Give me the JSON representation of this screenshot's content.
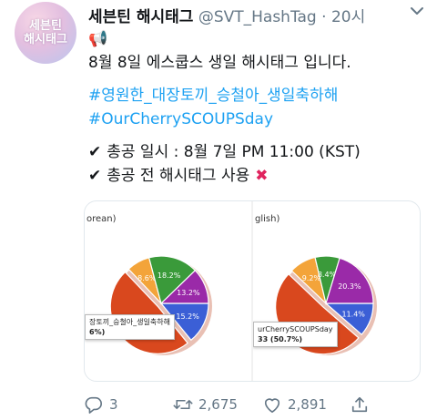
{
  "tweet": {
    "avatar_text": [
      "세븐틴",
      "해시태그"
    ],
    "display_name": "세븐틴 해시태그",
    "handle": "@SVT_HashTag",
    "separator": "·",
    "time": "20시",
    "lines": {
      "megaphone": "📢",
      "announcement": "8월 8일 에스쿱스 생일 해시태그 입니다.",
      "hashtag_korean": "#영원한_대장토끼_승철아_생일축하해",
      "hashtag_english": "#OurCherrySCOUPSday",
      "check_mark": "✔",
      "schedule": "총공 일시 : 8월 7일 PM 11:00 (KST)",
      "rule": "총공 전 해시태그 사용",
      "cross_mark": "✖"
    }
  },
  "media": {
    "left": {
      "label": "orean)",
      "tooltip_label": "장토끼_승철아_생일축하해",
      "tooltip_value": "6%)"
    },
    "right": {
      "label": "glish)",
      "tooltip_label": "urCherrySCOUPSday",
      "tooltip_value": "33 (50.7%)"
    }
  },
  "chart_data": [
    {
      "type": "pie",
      "slices": [
        {
          "label": "",
          "value": 15.2,
          "color": "#3b5fd6"
        },
        {
          "label": "",
          "value": 52.6,
          "color": "#d9481e"
        },
        {
          "label": "",
          "value": 8.6,
          "color": "#f3a43a"
        },
        {
          "label": "",
          "value": 18.2,
          "color": "#3a9a3a"
        },
        {
          "label": "",
          "value": 13.2,
          "color": "#9a2aa8"
        }
      ]
    },
    {
      "type": "pie",
      "slices": [
        {
          "label": "",
          "value": 11.4,
          "color": "#3b5fd6"
        },
        {
          "label": "",
          "value": 50.7,
          "color": "#d9481e"
        },
        {
          "label": "",
          "value": 9.2,
          "color": "#f3a43a"
        },
        {
          "label": "",
          "value": 8.4,
          "color": "#3a9a3a"
        },
        {
          "label": "",
          "value": 20.3,
          "color": "#9a2aa8"
        }
      ]
    }
  ],
  "actions": {
    "reply_count": "3",
    "retweet_count": "2,675",
    "like_count": "2,891"
  }
}
